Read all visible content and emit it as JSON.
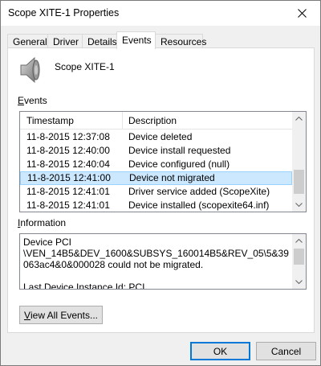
{
  "window": {
    "title": "Scope XITE-1 Properties",
    "close_glyph": "close-icon"
  },
  "tabs": [
    {
      "label": "General"
    },
    {
      "label": "Driver"
    },
    {
      "label": "Details"
    },
    {
      "label": "Events",
      "active": true
    },
    {
      "label": "Resources"
    }
  ],
  "device": {
    "name": "Scope XITE-1",
    "icon": "speaker-icon"
  },
  "events": {
    "label_prefix": "",
    "label_accel": "E",
    "label_rest": "vents",
    "columns": {
      "timestamp": "Timestamp",
      "description": "Description"
    },
    "rows": [
      {
        "timestamp": "11-8-2015 12:37:08",
        "description": "Device deleted"
      },
      {
        "timestamp": "11-8-2015 12:40:00",
        "description": "Device install requested"
      },
      {
        "timestamp": "11-8-2015 12:40:04",
        "description": "Device configured (null)"
      },
      {
        "timestamp": "11-8-2015 12:41:00",
        "description": "Device not migrated",
        "selected": true
      },
      {
        "timestamp": "11-8-2015 12:41:01",
        "description": "Driver service added (ScopeXite)"
      },
      {
        "timestamp": "11-8-2015 12:41:01",
        "description": "Device installed (scopexite64.inf)"
      }
    ]
  },
  "information": {
    "label_accel": "I",
    "label_rest": "nformation",
    "text": "Device PCI\n\\VEN_14B5&DEV_1600&SUBSYS_160014B5&REV_05\\5&39063ac4&0&000028 could not be migrated.\n\nLast Device Instance Id: PCI"
  },
  "buttons": {
    "view_all_accel": "V",
    "view_all_rest": "iew All Events...",
    "ok": "OK",
    "cancel": "Cancel"
  },
  "colors": {
    "selection_fill": "#cce8ff",
    "selection_border": "#99d1ff",
    "default_button_border": "#0078d7"
  }
}
